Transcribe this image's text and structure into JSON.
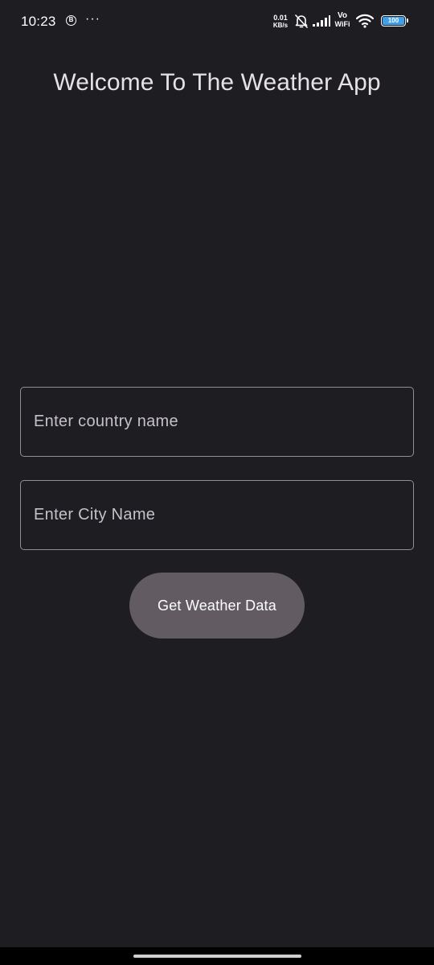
{
  "status_bar": {
    "time": "10:23",
    "b_badge": "B",
    "more": "···",
    "speed_value": "0.01",
    "speed_unit": "KB/s",
    "vowifi_top": "Vo",
    "vowifi_bottom": "WiFi",
    "battery_level": "100",
    "battery_color": "#3ea0ea",
    "icons": [
      "b-badge-icon",
      "bell-off-icon",
      "signal-icon",
      "wifi-icon",
      "battery-icon"
    ]
  },
  "header": {
    "title": "Welcome To The Weather App"
  },
  "form": {
    "country_placeholder": "Enter country name",
    "country_value": "",
    "city_placeholder": "Enter City Name",
    "city_value": "",
    "submit_label": "Get Weather Data"
  },
  "colors": {
    "background": "#1e1d22",
    "button": "#625c62",
    "outline": "#938f99"
  }
}
